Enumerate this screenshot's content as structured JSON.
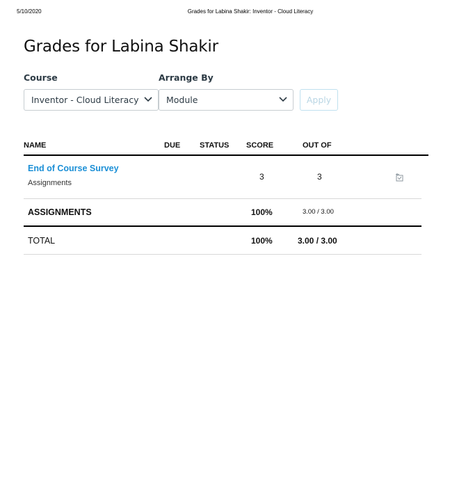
{
  "print_header": {
    "date": "5/10/2020",
    "title": "Grades for Labina Shakir: Inventor - Cloud Literacy"
  },
  "page_title": "Grades for Labina Shakir",
  "filters": {
    "course_label": "Course",
    "course_value": "Inventor - Cloud Literacy",
    "arrange_label": "Arrange By",
    "arrange_value": "Module",
    "apply_label": "Apply"
  },
  "table": {
    "headers": {
      "name": "NAME",
      "due": "DUE",
      "status": "STATUS",
      "score": "SCORE",
      "out_of": "OUT OF"
    },
    "rows": [
      {
        "name": "End of Course Survey",
        "group": "Assignments",
        "score": "3",
        "out_of": "3"
      }
    ],
    "group_summary": {
      "label": "ASSIGNMENTS",
      "score": "100%",
      "out_of": "3.00 / 3.00"
    },
    "total": {
      "label": "TOTAL",
      "score": "100%",
      "out_of": "3.00 / 3.00"
    }
  },
  "icons": [
    "chevron-down-icon",
    "rubric-icon"
  ],
  "colors": {
    "link": "#1b8fd6",
    "apply_disabled_text": "#b9d6e4",
    "apply_disabled_border": "#bfe0ef"
  }
}
